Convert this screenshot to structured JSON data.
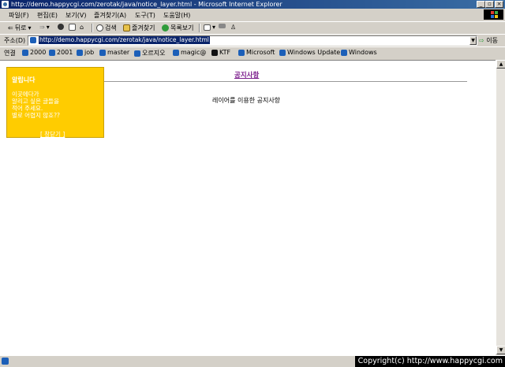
{
  "window": {
    "title": "http://demo.happycgi.com/zerotak/java/notice_layer.html - Microsoft Internet Explorer"
  },
  "menu": [
    "파일(F)",
    "편집(E)",
    "보기(V)",
    "즐겨찾기(A)",
    "도구(T)",
    "도움말(H)"
  ],
  "toolbar": {
    "back": "뒤로",
    "search": "검색",
    "favorites": "즐겨찾기",
    "history": "목록보기"
  },
  "address": {
    "label": "주소(D)",
    "url": "http://demo.happycgi.com/zerotak/java/notice_layer.html",
    "go": "이동"
  },
  "links": {
    "label": "연결",
    "items": [
      "2000",
      "2001",
      "job",
      "master",
      "오르지오",
      "magic@",
      "KTF",
      "Microsoft",
      "Windows Update",
      "Windows"
    ]
  },
  "page": {
    "notice_title": "공지사항",
    "body_text": "레이어를 이용한 공지사항"
  },
  "layer": {
    "title": "알립니다",
    "body": "이곳에다가\n알리고 싶은 글들을\n적어 주세요.\n별로 어렵지 않죠??",
    "close": "[ 창닫기 ]"
  },
  "status": {
    "copyright": "Copyright(c) http://www.happycgi.com"
  },
  "colors": {
    "titlebar": "#0a246a",
    "layer_bg": "#ffcc00",
    "notice_link": "#7b1c8c"
  }
}
